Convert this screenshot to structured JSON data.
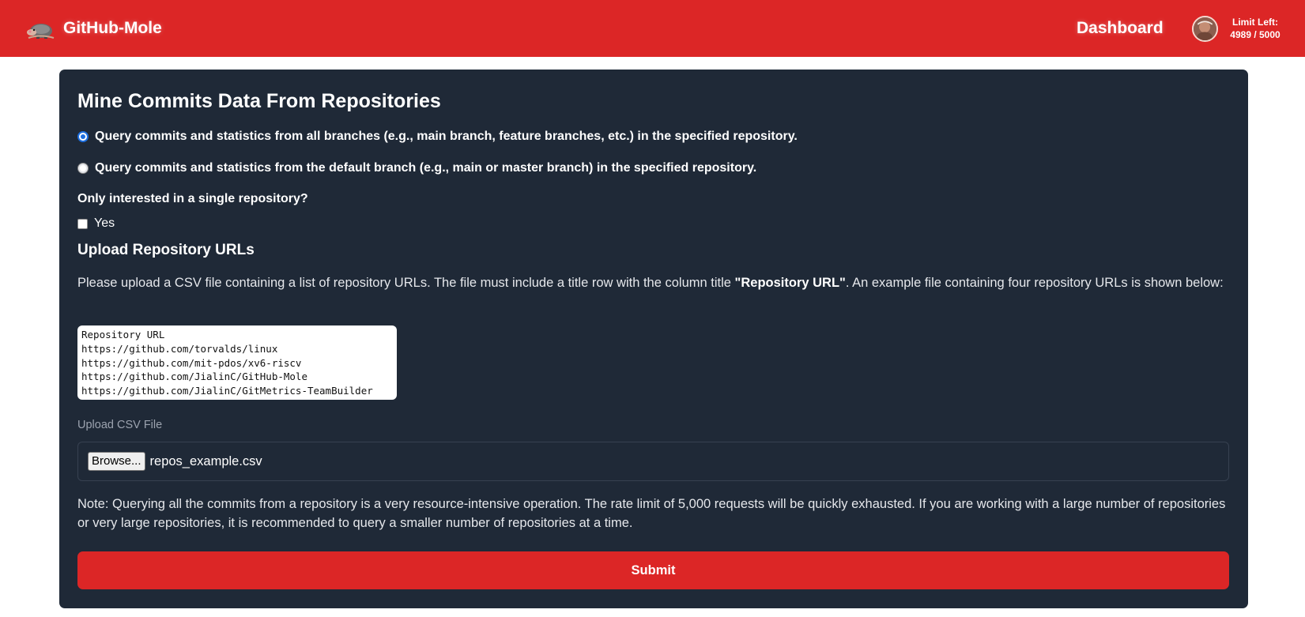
{
  "header": {
    "brand": "GitHub-Mole",
    "logo_icon": "mole-icon",
    "nav_dashboard": "Dashboard",
    "limit_label": "Limit Left:",
    "limit_value": "4989 / 5000",
    "brand_color": "#dc2626"
  },
  "form": {
    "title": "Mine Commits Data From Repositories",
    "branch_options": [
      {
        "label": "Query commits and statistics from all branches (e.g., main branch, feature branches, etc.) in the specified repository.",
        "selected": true
      },
      {
        "label": "Query commits and statistics from the default branch (e.g., main or master branch) in the specified repository.",
        "selected": false
      }
    ],
    "single_repo_question": "Only interested in a single repository?",
    "single_repo_checkbox_label": "Yes",
    "single_repo_checked": false,
    "upload_heading": "Upload Repository URLs",
    "description_before": "Please upload a CSV file containing a list of repository URLs. The file must include a title row with the column title ",
    "description_bold": "\"Repository URL\"",
    "description_after": ". An example file containing four repository URLs is shown below:",
    "example_lines": [
      "Repository URL",
      "https://github.com/torvalds/linux",
      "https://github.com/mit-pdos/xv6-riscv",
      "https://github.com/JialinC/GitHub-Mole",
      "https://github.com/JialinC/GitMetrics-TeamBuilder"
    ],
    "upload_label": "Upload CSV File",
    "browse_label": "Browse...",
    "file_name": "repos_example.csv",
    "note": "Note: Querying all the commits from a repository is a very resource-intensive operation. The rate limit of 5,000 requests will be quickly exhausted. If you are working with a large number of repositories or very large repositories, it is recommended to query a smaller number of repositories at a time.",
    "submit_label": "Submit",
    "panel_color": "#1f2937"
  }
}
